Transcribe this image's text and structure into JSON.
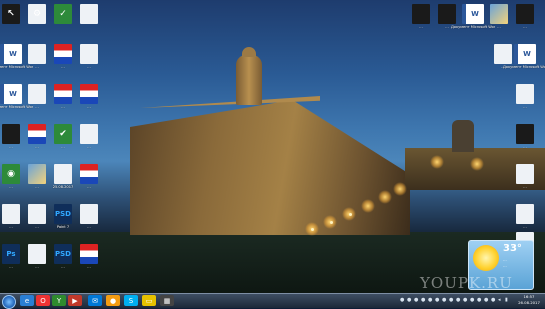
{
  "desktop": {
    "icons": [
      {
        "label": "",
        "kind": "bl",
        "glyph": "↖"
      },
      {
        "label": "",
        "kind": "doc",
        "glyph": "⚙"
      },
      {
        "label": "",
        "kind": "grn",
        "glyph": "✓"
      },
      {
        "label": "",
        "kind": "doc",
        "glyph": ""
      },
      {
        "label": "Документ Microsoft Word",
        "kind": "word",
        "glyph": "W"
      },
      {
        "label": "...",
        "kind": "doc",
        "glyph": ""
      },
      {
        "label": "...",
        "kind": "flag",
        "glyph": ""
      },
      {
        "label": "...",
        "kind": "doc",
        "glyph": ""
      },
      {
        "label": "Документ Microsoft Word",
        "kind": "word",
        "glyph": "W"
      },
      {
        "label": "...",
        "kind": "doc",
        "glyph": ""
      },
      {
        "label": "...",
        "kind": "flag",
        "glyph": ""
      },
      {
        "label": "...",
        "kind": "flag",
        "glyph": ""
      },
      {
        "label": "...",
        "kind": "bl",
        "glyph": ""
      },
      {
        "label": "...",
        "kind": "flag",
        "glyph": ""
      },
      {
        "label": "...",
        "kind": "grn",
        "glyph": "✔"
      },
      {
        "label": "...",
        "kind": "doc",
        "glyph": ""
      },
      {
        "label": "...",
        "kind": "grn",
        "glyph": "◉"
      },
      {
        "label": "...",
        "kind": "pic",
        "glyph": ""
      },
      {
        "label": "25.08.2017",
        "kind": "doc",
        "glyph": ""
      },
      {
        "label": "...",
        "kind": "flag",
        "glyph": ""
      },
      {
        "label": "...",
        "kind": "doc",
        "glyph": ""
      },
      {
        "label": "...",
        "kind": "doc",
        "glyph": ""
      },
      {
        "label": "Paint 7",
        "kind": "ps",
        "glyph": "PSD"
      },
      {
        "label": "...",
        "kind": "doc",
        "glyph": ""
      },
      {
        "label": "...",
        "kind": "ps",
        "glyph": "Ps"
      },
      {
        "label": "...",
        "kind": "doc",
        "glyph": ""
      },
      {
        "label": "...",
        "kind": "ps",
        "glyph": "PSD"
      },
      {
        "label": "...",
        "kind": "flag",
        "glyph": ""
      },
      {
        "label": "...",
        "kind": "flag",
        "glyph": ""
      },
      {
        "label": "...",
        "kind": "grn",
        "glyph": "✳"
      },
      {
        "label": "...",
        "kind": "doc",
        "glyph": ""
      },
      {
        "label": "...",
        "kind": "bl",
        "glyph": ""
      }
    ],
    "right_icons": [
      {
        "label": "...",
        "kind": "bl",
        "glyph": ""
      },
      {
        "label": "...",
        "kind": "bl",
        "glyph": ""
      },
      {
        "label": "Документ Microsoft Word",
        "kind": "word",
        "glyph": "W"
      },
      {
        "label": "...",
        "kind": "pic",
        "glyph": ""
      },
      {
        "label": "...",
        "kind": "bl",
        "glyph": ""
      },
      {
        "label": "...",
        "kind": "doc",
        "glyph": ""
      },
      {
        "label": "Документ Microsoft Word",
        "kind": "word",
        "glyph": "W"
      },
      {
        "label": "...",
        "kind": "doc",
        "glyph": ""
      },
      {
        "label": "...",
        "kind": "bl",
        "glyph": ""
      },
      {
        "label": "...",
        "kind": "doc",
        "glyph": ""
      },
      {
        "label": "...",
        "kind": "doc",
        "glyph": ""
      },
      {
        "label": "...",
        "kind": "doc",
        "glyph": ""
      }
    ]
  },
  "gadget": {
    "temp": "33°",
    "line1": "...",
    "line2": "..."
  },
  "watermark": "YOUPK.RU",
  "taskbar": {
    "clock_time": "16:57",
    "clock_date": "26.08.2017"
  }
}
